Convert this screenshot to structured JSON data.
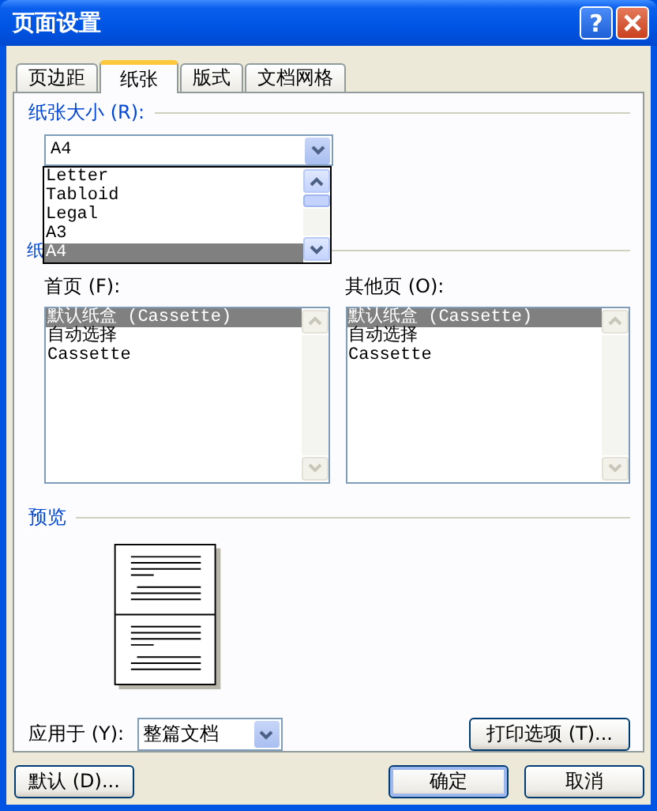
{
  "window": {
    "title": "页面设置",
    "help": "?"
  },
  "tabs": [
    {
      "label": "页边距",
      "selected": false
    },
    {
      "label": "纸张",
      "selected": true
    },
    {
      "label": "版式",
      "selected": false
    },
    {
      "label": "文档网格",
      "selected": false
    }
  ],
  "paper_size": {
    "label": "纸张大小 (R):",
    "value": "A4",
    "options": [
      {
        "label": "Letter",
        "selected": false
      },
      {
        "label": "Tabloid",
        "selected": false
      },
      {
        "label": "Legal",
        "selected": false
      },
      {
        "label": "A3",
        "selected": false
      },
      {
        "label": "A4",
        "selected": true
      }
    ]
  },
  "paper_source": {
    "label": "纸"
  },
  "trays": [
    {
      "label": "首页 (F):",
      "items": [
        {
          "label": "默认纸盒 (Cassette)",
          "selected": true
        },
        {
          "label": "自动选择",
          "selected": false
        },
        {
          "label": "Cassette",
          "selected": false
        }
      ]
    },
    {
      "label": "其他页 (O):",
      "items": [
        {
          "label": "默认纸盒 (Cassette)",
          "selected": true
        },
        {
          "label": "自动选择",
          "selected": false
        },
        {
          "label": "Cassette",
          "selected": false
        }
      ]
    }
  ],
  "preview": {
    "label": "预览"
  },
  "apply_to": {
    "label": "应用于 (Y):",
    "value": "整篇文档"
  },
  "print_options_button": "打印选项 (T)...",
  "buttons": [
    {
      "label": "默认 (D)...",
      "default": false
    },
    {
      "label": "确定",
      "default": true
    },
    {
      "label": "取消",
      "default": false
    }
  ]
}
